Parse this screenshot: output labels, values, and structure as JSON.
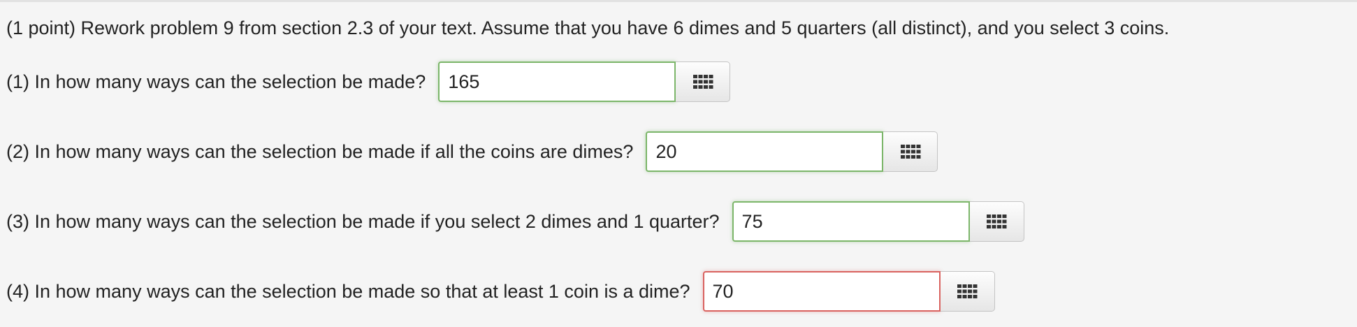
{
  "problem": {
    "intro": "(1 point) Rework problem 9 from section 2.3 of your text. Assume that you have 6 dimes and 5 quarters (all distinct), and you select 3 coins."
  },
  "questions": [
    {
      "label": "(1) In how many ways can the selection be made?",
      "answer": "165",
      "status": "correct"
    },
    {
      "label": "(2) In how many ways can the selection be made if all the coins are dimes?",
      "answer": "20",
      "status": "correct"
    },
    {
      "label": "(3) In how many ways can the selection be made if you select 2 dimes and 1 quarter?",
      "answer": "75",
      "status": "correct"
    },
    {
      "label": "(4) In how many ways can the selection be made so that at least 1 coin is a dime?",
      "answer": "70",
      "status": "incorrect"
    }
  ],
  "icons": {
    "keypad": "keypad-icon"
  },
  "colors": {
    "background": "#f5f5f5",
    "correct_border": "#7cb66a",
    "incorrect_border": "#d9625f"
  }
}
